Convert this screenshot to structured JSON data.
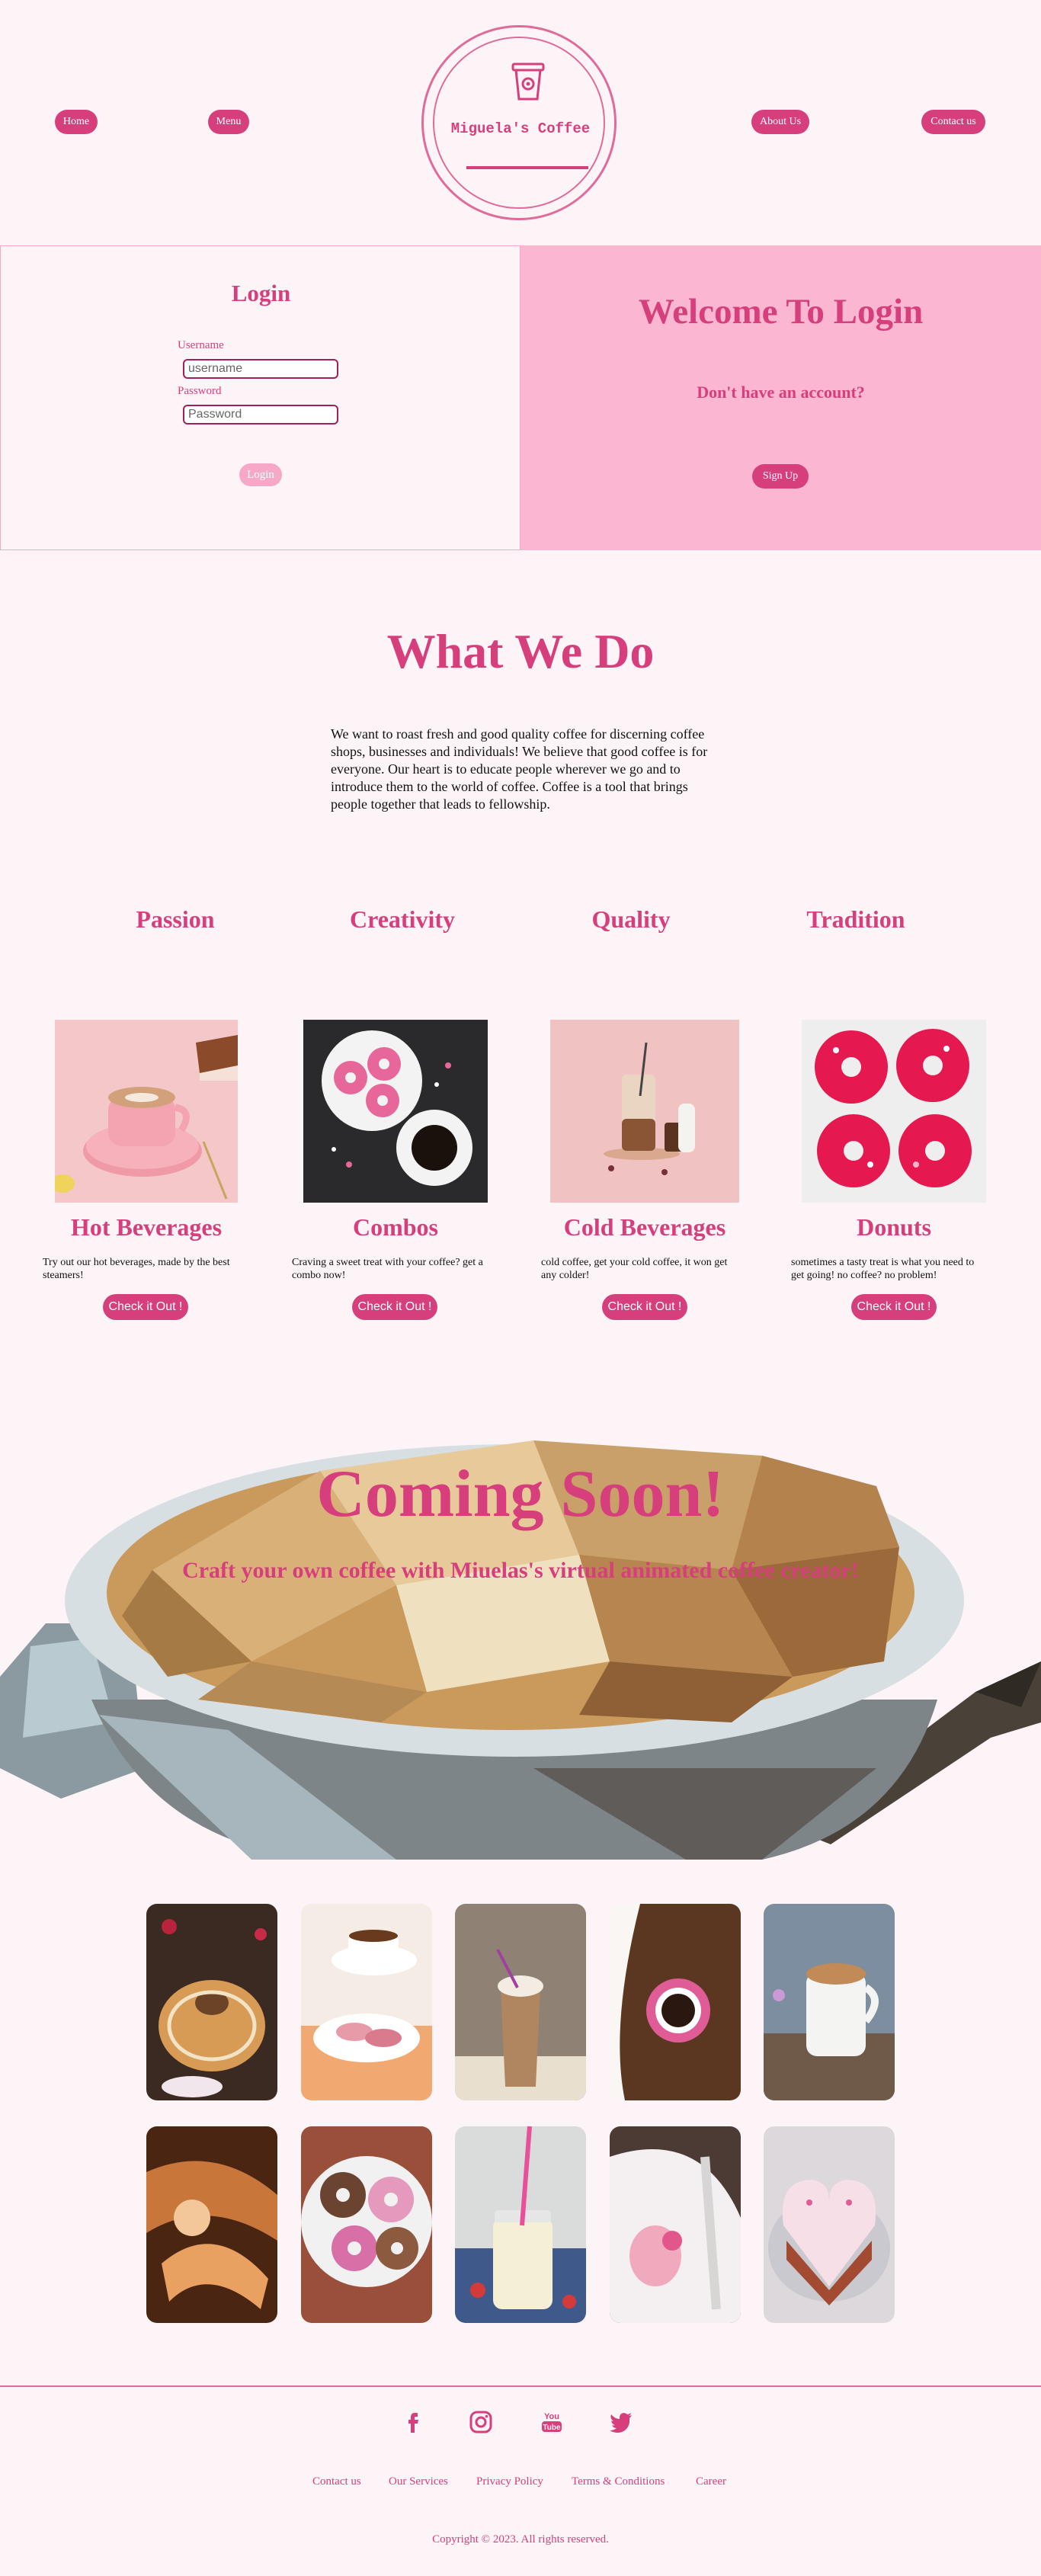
{
  "nav": {
    "home": "Home",
    "menu": "Menu",
    "about": "About Us",
    "contact": "Contact us"
  },
  "logo": {
    "name": "Miguela's Coffee",
    "icon": "coffee-cup-icon"
  },
  "login": {
    "title": "Login",
    "username_label": "Username",
    "username_placeholder": "username",
    "password_label": "Password",
    "password_placeholder": "Password",
    "button": "Login"
  },
  "welcome": {
    "title": "Welcome To Login",
    "prompt": "Don't have an account?",
    "signup": "Sign Up"
  },
  "what_we_do": {
    "title": "What We Do",
    "text": "We want to roast fresh and good quality coffee for discerning coffee shops, businesses and individuals! We believe that good coffee is for everyone. Our heart is to educate people wherever we go and to introduce them to the world of coffee. Coffee is a tool that brings people together that leads to fellowship.",
    "values": [
      "Passion",
      "Creativity",
      "Quality",
      "Tradition"
    ]
  },
  "products": [
    {
      "title": "Hot Beverages",
      "desc": "Try out our hot beverages, made by the best steamers!",
      "button": "Check it Out !"
    },
    {
      "title": "Combos",
      "desc": "Craving a sweet treat with your coffee? get a combo now!",
      "button": "Check it Out !"
    },
    {
      "title": "Cold Beverages",
      "desc": "cold coffee, get your cold coffee, it won get any colder!",
      "button": "Check it Out !"
    },
    {
      "title": "Donuts",
      "desc": "sometimes a tasty treat is what you need to get going! no coffee? no problem!",
      "button": "Check it Out !"
    }
  ],
  "coming_soon": {
    "title": "Coming Soon!",
    "subtitle": "Craft your own coffee with Miuelas's virtual animated coffee creator!"
  },
  "footer": {
    "social": [
      "facebook-icon",
      "instagram-icon",
      "youtube-icon",
      "twitter-icon"
    ],
    "links": [
      "Contact us",
      "Our Services",
      "Privacy Policy",
      "Terms & Conditions",
      "Career"
    ],
    "copyright": "Copyright © 2023. All rights reserved."
  },
  "colors": {
    "accent": "#d63f7c",
    "panel": "#fbb6d1",
    "background": "#fcf4f7"
  }
}
